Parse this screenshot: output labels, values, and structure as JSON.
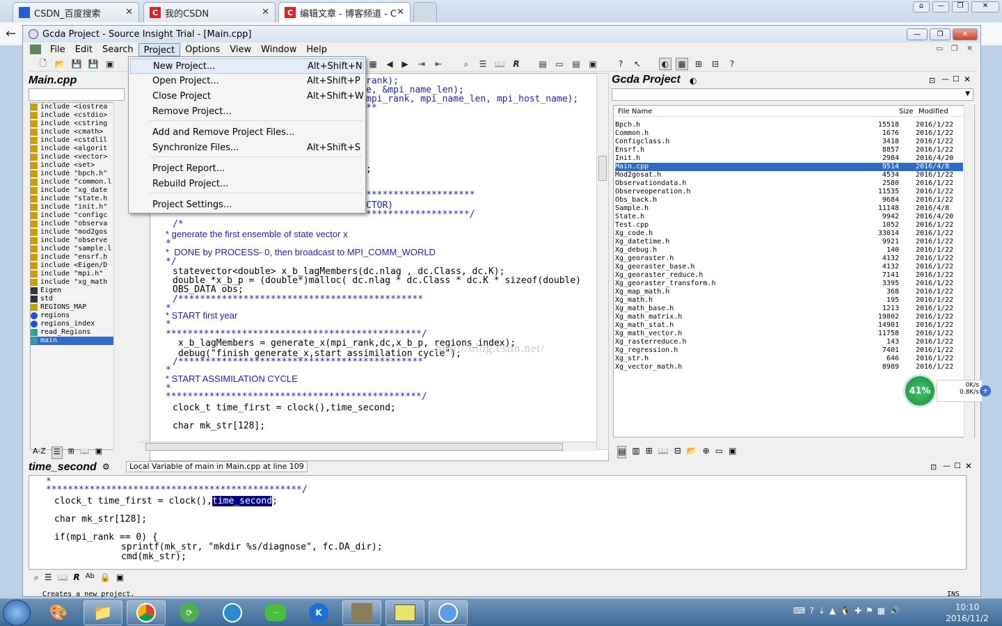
{
  "browser": {
    "tabs": [
      {
        "label": "CSDN_百度搜索",
        "active": false
      },
      {
        "label": "我的CSDN",
        "active": false
      },
      {
        "label": "编辑文章 - 博客频道 - C",
        "active": true
      }
    ]
  },
  "app": {
    "title": "Gcda Project - Source Insight Trial - [Main.cpp]",
    "menu": [
      "File",
      "Edit",
      "Search",
      "Project",
      "Options",
      "View",
      "Window",
      "Help"
    ],
    "open_menu": "Project"
  },
  "dropdown": {
    "items": [
      {
        "label": "New Project...",
        "shortcut": "Alt+Shift+N",
        "highlight": true
      },
      {
        "label": "Open Project...",
        "shortcut": "Alt+Shift+P"
      },
      {
        "label": "Close Project",
        "shortcut": "Alt+Shift+W"
      },
      {
        "label": "Remove Project...",
        "shortcut": ""
      },
      {
        "label": "Add and Remove Project Files...",
        "shortcut": ""
      },
      {
        "label": "Synchronize Files...",
        "shortcut": "Alt+Shift+S"
      },
      {
        "label": "Project Report...",
        "shortcut": ""
      },
      {
        "label": "Rebuild Project...",
        "shortcut": ""
      },
      {
        "label": "Project Settings...",
        "shortcut": ""
      }
    ]
  },
  "symbol_panel": {
    "title": "Main.cpp",
    "symbols": [
      {
        "text": "include <iostrea",
        "type": "include"
      },
      {
        "text": "include <cstdio>",
        "type": "include"
      },
      {
        "text": "include <cstring",
        "type": "include"
      },
      {
        "text": "include <cmath>",
        "type": "include"
      },
      {
        "text": "include <cstdlil",
        "type": "include"
      },
      {
        "text": "include <algorit",
        "type": "include"
      },
      {
        "text": "include <vector>",
        "type": "include"
      },
      {
        "text": "include <set>",
        "type": "include"
      },
      {
        "text": "include \"bpch.h\"",
        "type": "include"
      },
      {
        "text": "include \"common.l",
        "type": "include"
      },
      {
        "text": "include \"xg_date",
        "type": "include"
      },
      {
        "text": "include \"state.h",
        "type": "include"
      },
      {
        "text": "include \"init.h\"",
        "type": "include"
      },
      {
        "text": "include \"configc",
        "type": "include"
      },
      {
        "text": "include \"observa",
        "type": "include"
      },
      {
        "text": "include \"mod2gos",
        "type": "include"
      },
      {
        "text": "include \"observe",
        "type": "include"
      },
      {
        "text": "include \"sample.l",
        "type": "include"
      },
      {
        "text": "include \"ensrf.h",
        "type": "include"
      },
      {
        "text": "include <Eigen/D",
        "type": "include"
      },
      {
        "text": "include \"mpi.h\"",
        "type": "include"
      },
      {
        "text": "include \"xg_math",
        "type": "include"
      },
      {
        "text": "Eigen",
        "type": "namespace"
      },
      {
        "text": "std",
        "type": "namespace"
      },
      {
        "text": "REGIONS_MAP",
        "type": "macro"
      },
      {
        "text": "regions",
        "type": "var"
      },
      {
        "text": "regions_index",
        "type": "var"
      },
      {
        "text": "read_Regions",
        "type": "func"
      },
      {
        "text": "main",
        "type": "func",
        "selected": true
      }
    ]
  },
  "editor": {
    "lines": [
      {
        "t": "rank);",
        "c": "#2020c0"
      },
      {
        "t": "e, &mpi_name_len);",
        "c": "#2020c0"
      },
      {
        "t": "mpi_rank, mpi_name_len, mpi_host_name);",
        "c": "#2020c0"
      },
      {
        "t": "**",
        "c": "#2020c0"
      },
      {
        "t": ";",
        "c": "#000"
      },
      {
        "t": "********************",
        "c": "#2020c0"
      },
      {
        "t": "CTOR)",
        "c": "#2020c0"
      },
      {
        "t": "*******************/",
        "c": "#2020c0"
      },
      {
        "t": "/*",
        "c": "#2020c0"
      },
      {
        "t": "* generate the first ensemble of state vector x",
        "c": "#2020c0"
      },
      {
        "t": "*",
        "c": "#2020c0"
      },
      {
        "t": "*  DONE by PROCESS- 0, then broadcast to MPI_COMM_WORLD",
        "c": "#2020c0"
      },
      {
        "t": "*/",
        "c": "#2020c0"
      },
      {
        "t": "statevector<double> x_b_lagMembers(dc.nlag , dc.Class, dc.K);",
        "c": "#000"
      },
      {
        "t": "double *x_b_p = (double*)malloc( dc.nlag * dc.Class * dc.K * sizeof(double)",
        "c": "#000"
      },
      {
        "t": "OBS_DATA obs;",
        "c": "#000"
      },
      {
        "t": "/*********************************************",
        "c": "#2020c0"
      },
      {
        "t": "*",
        "c": "#2020c0"
      },
      {
        "t": "* START first year",
        "c": "#2020c0"
      },
      {
        "t": "*",
        "c": "#2020c0"
      },
      {
        "t": "***********************************************/",
        "c": "#2020c0"
      },
      {
        "t": "x_b_lagMembers = generate_x(mpi_rank,dc,x_b_p, regions_index);",
        "c": "#000"
      },
      {
        "t": "debug(\"finish generate_x,start assimilation cycle\");",
        "c": "#000"
      },
      {
        "t": "/*********************************************",
        "c": "#2020c0"
      },
      {
        "t": "*",
        "c": "#2020c0"
      },
      {
        "t": "* START ASSIMILATION CYCLE",
        "c": "#2020c0"
      },
      {
        "t": "*",
        "c": "#2020c0"
      },
      {
        "t": "***********************************************/",
        "c": "#2020c0"
      },
      {
        "t": "clock_t time_first = clock(),time_second;",
        "c": "#000"
      },
      {
        "t": "char mk_str[128];",
        "c": "#000"
      }
    ],
    "watermark": "http://blog.csdn.net/"
  },
  "project_panel": {
    "title": "Gcda Project",
    "headers": {
      "name": "File Name",
      "size": "Size",
      "modified": "Modified"
    },
    "files": [
      {
        "name": "Bpch.h",
        "size": "15518",
        "date": "2016/1/22"
      },
      {
        "name": "Common.h",
        "size": "1676",
        "date": "2016/1/22"
      },
      {
        "name": "Configclass.h",
        "size": "3418",
        "date": "2016/1/22"
      },
      {
        "name": "Ensrf.h",
        "size": "8857",
        "date": "2016/1/22"
      },
      {
        "name": "Init.h",
        "size": "2984",
        "date": "2016/4/20"
      },
      {
        "name": "Main.cpp",
        "size": "9514",
        "date": "2016/4/8",
        "selected": true
      },
      {
        "name": "Mod2gosat.h",
        "size": "4534",
        "date": "2016/1/22"
      },
      {
        "name": "Observationdata.h",
        "size": "2580",
        "date": "2016/1/22"
      },
      {
        "name": "Observeoperation.h",
        "size": "11535",
        "date": "2016/1/22"
      },
      {
        "name": "Obs_back.h",
        "size": "9684",
        "date": "2016/1/22"
      },
      {
        "name": "Sample.h",
        "size": "11148",
        "date": "2016/4/8"
      },
      {
        "name": "State.h",
        "size": "9942",
        "date": "2016/4/20"
      },
      {
        "name": "Test.cpp",
        "size": "1052",
        "date": "2016/1/22"
      },
      {
        "name": "Xg_code.h",
        "size": "33014",
        "date": "2016/1/22"
      },
      {
        "name": "Xg_datetime.h",
        "size": "9921",
        "date": "2016/1/22"
      },
      {
        "name": "Xg_debug.h",
        "size": "140",
        "date": "2016/1/22"
      },
      {
        "name": "Xg_georaster.h",
        "size": "4132",
        "date": "2016/1/22"
      },
      {
        "name": "Xg_georaster_base.h",
        "size": "4132",
        "date": "2016/1/22"
      },
      {
        "name": "Xg_georaster_reduce.h",
        "size": "7141",
        "date": "2016/1/22"
      },
      {
        "name": "Xg_georaster_transform.h",
        "size": "3395",
        "date": "2016/1/22"
      },
      {
        "name": "Xg_map_math.h",
        "size": "368",
        "date": "2016/1/22"
      },
      {
        "name": "Xg_math.h",
        "size": "195",
        "date": "2016/1/22"
      },
      {
        "name": "Xg_math_base.h",
        "size": "1213",
        "date": "2016/1/22"
      },
      {
        "name": "Xg_math_matrix.h",
        "size": "19802",
        "date": "2016/1/22"
      },
      {
        "name": "Xg_math_stat.h",
        "size": "14901",
        "date": "2016/1/22"
      },
      {
        "name": "Xg_math_vector.h",
        "size": "11758",
        "date": "2016/1/22"
      },
      {
        "name": "Xg_rasterreduce.h",
        "size": "143",
        "date": "2016/1/22"
      },
      {
        "name": "Xg_regression.h",
        "size": "7401",
        "date": "2016/1/22"
      },
      {
        "name": "Xg_str.h",
        "size": "646",
        "date": "2016/1/22"
      },
      {
        "name": "Xg_vector_math.h",
        "size": "8989",
        "date": "2016/1/22"
      }
    ]
  },
  "context_panel": {
    "title": "time_second",
    "info": "Local Variable of main in Main.cpp at line 109",
    "lines": [
      {
        "t": "*",
        "c": "#2020c0"
      },
      {
        "t": "***********************************************/",
        "c": "#2020c0"
      },
      {
        "t": "clock_t time_first = clock(),time_second;",
        "c": "#000"
      },
      {
        "t": "char mk_str[128];",
        "c": "#000"
      },
      {
        "t": "if(mpi_rank == 0) {",
        "c": "#000"
      },
      {
        "t": "sprintf(mk_str, \"mkdir %s/diagnose\", fc.DA_dir);",
        "c": "#000"
      },
      {
        "t": "cmd(mk_str);",
        "c": "#000"
      }
    ],
    "highlight_word": "time_second"
  },
  "status": {
    "message": "Creates a new project.",
    "mode": "INS"
  },
  "net_widget": {
    "percent": "41%",
    "up": "0K/s",
    "down": "0.8K/s"
  },
  "taskbar": {
    "time": "10:10",
    "date": "2016/11/2"
  }
}
